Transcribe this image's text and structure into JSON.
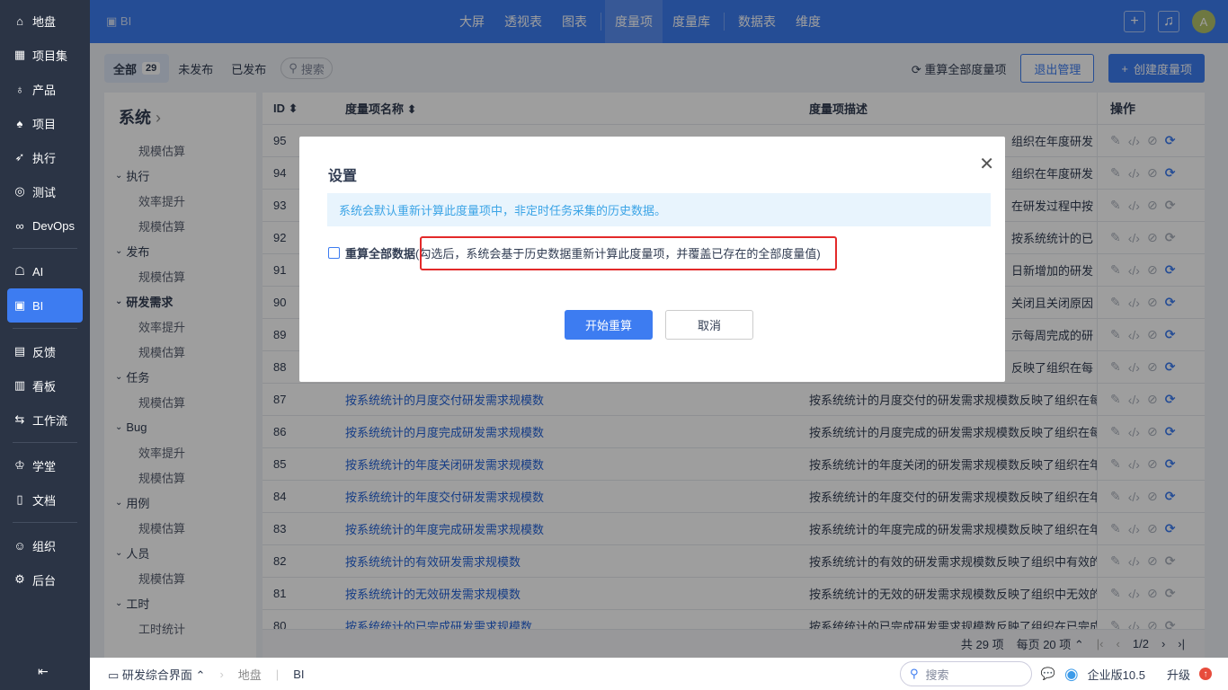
{
  "sidebar": {
    "items": [
      {
        "icon": "home-icon",
        "glyph": "⌂",
        "label": "地盘"
      },
      {
        "icon": "grid-icon",
        "glyph": "▦",
        "label": "项目集"
      },
      {
        "icon": "bulb-icon",
        "glyph": "♁",
        "label": "产品"
      },
      {
        "icon": "rocket-icon",
        "glyph": "♠",
        "label": "项目"
      },
      {
        "icon": "run-icon",
        "glyph": "➶",
        "label": "执行"
      },
      {
        "icon": "test-icon",
        "glyph": "◎",
        "label": "测试"
      },
      {
        "icon": "devops-icon",
        "glyph": "∞",
        "label": "DevOps"
      },
      {
        "icon": "ai-icon",
        "glyph": "☖",
        "label": "AI"
      },
      {
        "icon": "bi-icon",
        "glyph": "▣",
        "label": "BI"
      },
      {
        "icon": "feedback-icon",
        "glyph": "▤",
        "label": "反馈"
      },
      {
        "icon": "kanban-icon",
        "glyph": "▥",
        "label": "看板"
      },
      {
        "icon": "workflow-icon",
        "glyph": "⇆",
        "label": "工作流"
      },
      {
        "icon": "school-icon",
        "glyph": "♔",
        "label": "学堂"
      },
      {
        "icon": "doc-icon",
        "glyph": "▯",
        "label": "文档"
      },
      {
        "icon": "org-icon",
        "glyph": "☺",
        "label": "组织"
      },
      {
        "icon": "gear-icon",
        "glyph": "⚙",
        "label": "后台"
      }
    ],
    "collapse": "⇤"
  },
  "header": {
    "module": "BI",
    "tabs": [
      "大屏",
      "透视表",
      "图表",
      "度量项",
      "度量库",
      "数据表",
      "维度"
    ],
    "active": "度量项",
    "avatar": "A"
  },
  "toolbar": {
    "filters": [
      "全部",
      "未发布",
      "已发布"
    ],
    "count": "29",
    "search": "搜索",
    "recalc_all": "重算全部度量项",
    "exit": "退出管理",
    "create": "创建度量项"
  },
  "tree": {
    "title": "系统",
    "nodes": [
      {
        "t": "规模估算",
        "leaf": true
      },
      {
        "t": "执行"
      },
      {
        "t": "效率提升",
        "leaf": true
      },
      {
        "t": "规模估算",
        "leaf": true
      },
      {
        "t": "发布"
      },
      {
        "t": "规模估算",
        "leaf": true
      },
      {
        "t": "研发需求",
        "bold": true
      },
      {
        "t": "效率提升",
        "leaf": true
      },
      {
        "t": "规模估算",
        "leaf": true
      },
      {
        "t": "任务"
      },
      {
        "t": "规模估算",
        "leaf": true
      },
      {
        "t": "Bug"
      },
      {
        "t": "效率提升",
        "leaf": true
      },
      {
        "t": "规模估算",
        "leaf": true
      },
      {
        "t": "用例"
      },
      {
        "t": "规模估算",
        "leaf": true
      },
      {
        "t": "人员"
      },
      {
        "t": "规模估算",
        "leaf": true
      },
      {
        "t": "工时"
      },
      {
        "t": "工时统计",
        "leaf": true
      }
    ]
  },
  "table": {
    "columns": [
      "ID",
      "度量项名称",
      "度量项描述",
      "操作"
    ],
    "rows": [
      {
        "id": "95",
        "name": "",
        "desc": "组织在年度研发",
        "frag": true,
        "active": true
      },
      {
        "id": "94",
        "name": "",
        "desc": "组织在年度研发",
        "frag": true,
        "active": true
      },
      {
        "id": "93",
        "name": "",
        "desc": "在研发过程中按",
        "frag": true,
        "active": false
      },
      {
        "id": "92",
        "name": "",
        "desc": "按系统统计的已",
        "frag": true,
        "active": false
      },
      {
        "id": "91",
        "name": "",
        "desc": "日新增加的研发",
        "frag": true,
        "active": true
      },
      {
        "id": "90",
        "name": "",
        "desc": "关闭且关闭原因",
        "frag": true,
        "active": true
      },
      {
        "id": "89",
        "name": "",
        "desc": "示每周完成的研",
        "frag": true,
        "active": true
      },
      {
        "id": "88",
        "name": "",
        "desc": "反映了组织在每",
        "frag": true,
        "active": true
      },
      {
        "id": "87",
        "name": "按系统统计的月度交付研发需求规模数",
        "desc": "按系统统计的月度交付的研发需求规模数反映了组织在每",
        "active": true
      },
      {
        "id": "86",
        "name": "按系统统计的月度完成研发需求规模数",
        "desc": "按系统统计的月度完成的研发需求规模数反映了组织在每",
        "active": true
      },
      {
        "id": "85",
        "name": "按系统统计的年度关闭研发需求规模数",
        "desc": "按系统统计的年度关闭的研发需求规模数反映了组织在年",
        "active": true
      },
      {
        "id": "84",
        "name": "按系统统计的年度交付研发需求规模数",
        "desc": "按系统统计的年度交付的研发需求规模数反映了组织在年",
        "active": true
      },
      {
        "id": "83",
        "name": "按系统统计的年度完成研发需求规模数",
        "desc": "按系统统计的年度完成的研发需求规模数反映了组织在年",
        "active": true
      },
      {
        "id": "82",
        "name": "按系统统计的有效研发需求规模数",
        "desc": "按系统统计的有效的研发需求规模数反映了组织中有效的",
        "active": false
      },
      {
        "id": "81",
        "name": "按系统统计的无效研发需求规模数",
        "desc": "按系统统计的无效的研发需求规模数反映了组织中无效的",
        "active": false
      },
      {
        "id": "80",
        "name": "按系统统计的已完成研发需求规模数",
        "desc": "按系统统计的已完成研发需求规模数反映了组织在已完成",
        "active": false
      }
    ]
  },
  "pager": {
    "total": "共 29 项",
    "per_page": "每页 20 项",
    "page": "1/2"
  },
  "modal": {
    "title": "设置",
    "info": "系统会默认重新计算此度量项中，非定时任务采集的历史数据。",
    "checkbox_label": "重算全部数据",
    "checkbox_hint": "(勾选后，系统会基于历史数据重新计算此度量项，并覆盖已存在的全部度量值)",
    "checked": false,
    "confirm": "开始重算",
    "cancel": "取消"
  },
  "bottom": {
    "screen": "研发综合界面",
    "crumbs": [
      "地盘",
      "BI"
    ],
    "search": "搜索",
    "edition": "企业版10.5",
    "upgrade": "升级"
  },
  "colors": {
    "primary": "#3d7cf1",
    "sidebar": "#2b3445",
    "highlight": "#e32a2a"
  }
}
